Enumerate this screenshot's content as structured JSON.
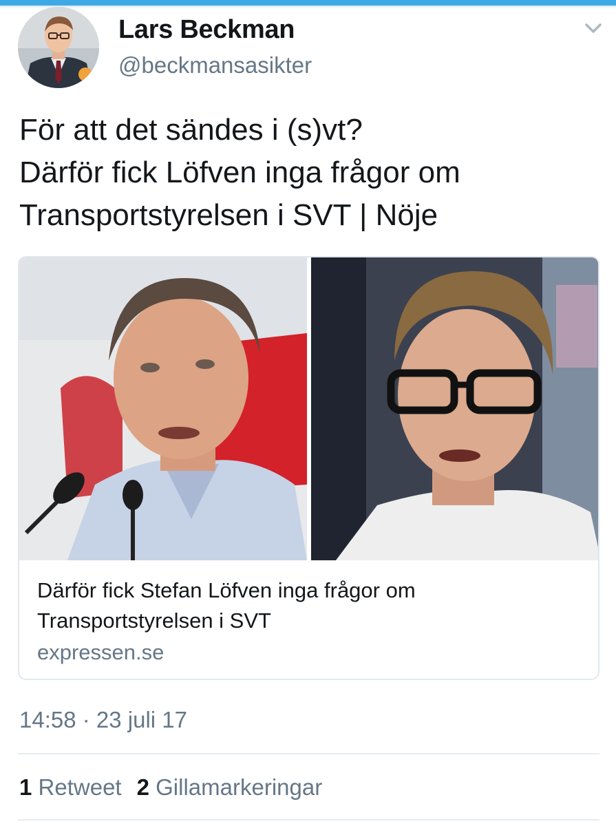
{
  "tweet": {
    "author_name": "Lars Beckman",
    "author_handle": "@beckmansasikter",
    "text_lines": [
      "För att det sändes i (s)vt?",
      "Därför fick Löfven inga frågor om",
      "Transportstyrelsen i SVT | Nöje"
    ],
    "timestamp": "14:58 · 23 juli 17"
  },
  "card": {
    "title_lines": [
      "Därför fick Stefan Löfven inga frågor om",
      "Transportstyrelsen i SVT"
    ],
    "domain": "expressen.se"
  },
  "stats": {
    "retweets_count": "1",
    "retweets_label": "Retweet",
    "likes_count": "2",
    "likes_label": "Gillamarkeringar"
  },
  "icons": {
    "menu": "chevron-down-icon"
  },
  "colors": {
    "accent": "#3fa9e6",
    "text_primary": "#14171a",
    "text_secondary": "#657786",
    "border": "#e1e8ed"
  }
}
